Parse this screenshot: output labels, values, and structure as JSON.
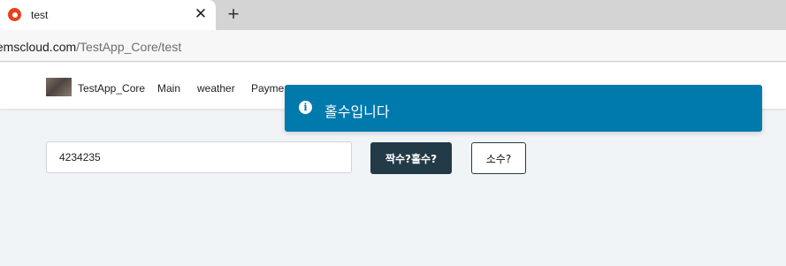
{
  "browser": {
    "tab_title": "test",
    "tab_close": "✕",
    "new_tab": "+",
    "url_host": "temscloud.com",
    "url_path": "/TestApp_Core/test",
    "favicon_color": "#e8401c"
  },
  "navbar": {
    "brand": "TestApp_Core",
    "items": [
      "Main",
      "weather",
      "Paymen"
    ]
  },
  "toast": {
    "icon": "info-icon",
    "icon_glyph": "i",
    "message": "홀수입니다",
    "color": "#0079ad"
  },
  "form": {
    "number_value": "4234235",
    "parity_button": "짝수?홀수?",
    "prime_button": "소수?"
  },
  "colors": {
    "primary_dark": "#233a47",
    "page_background": "#f1f4f7"
  }
}
